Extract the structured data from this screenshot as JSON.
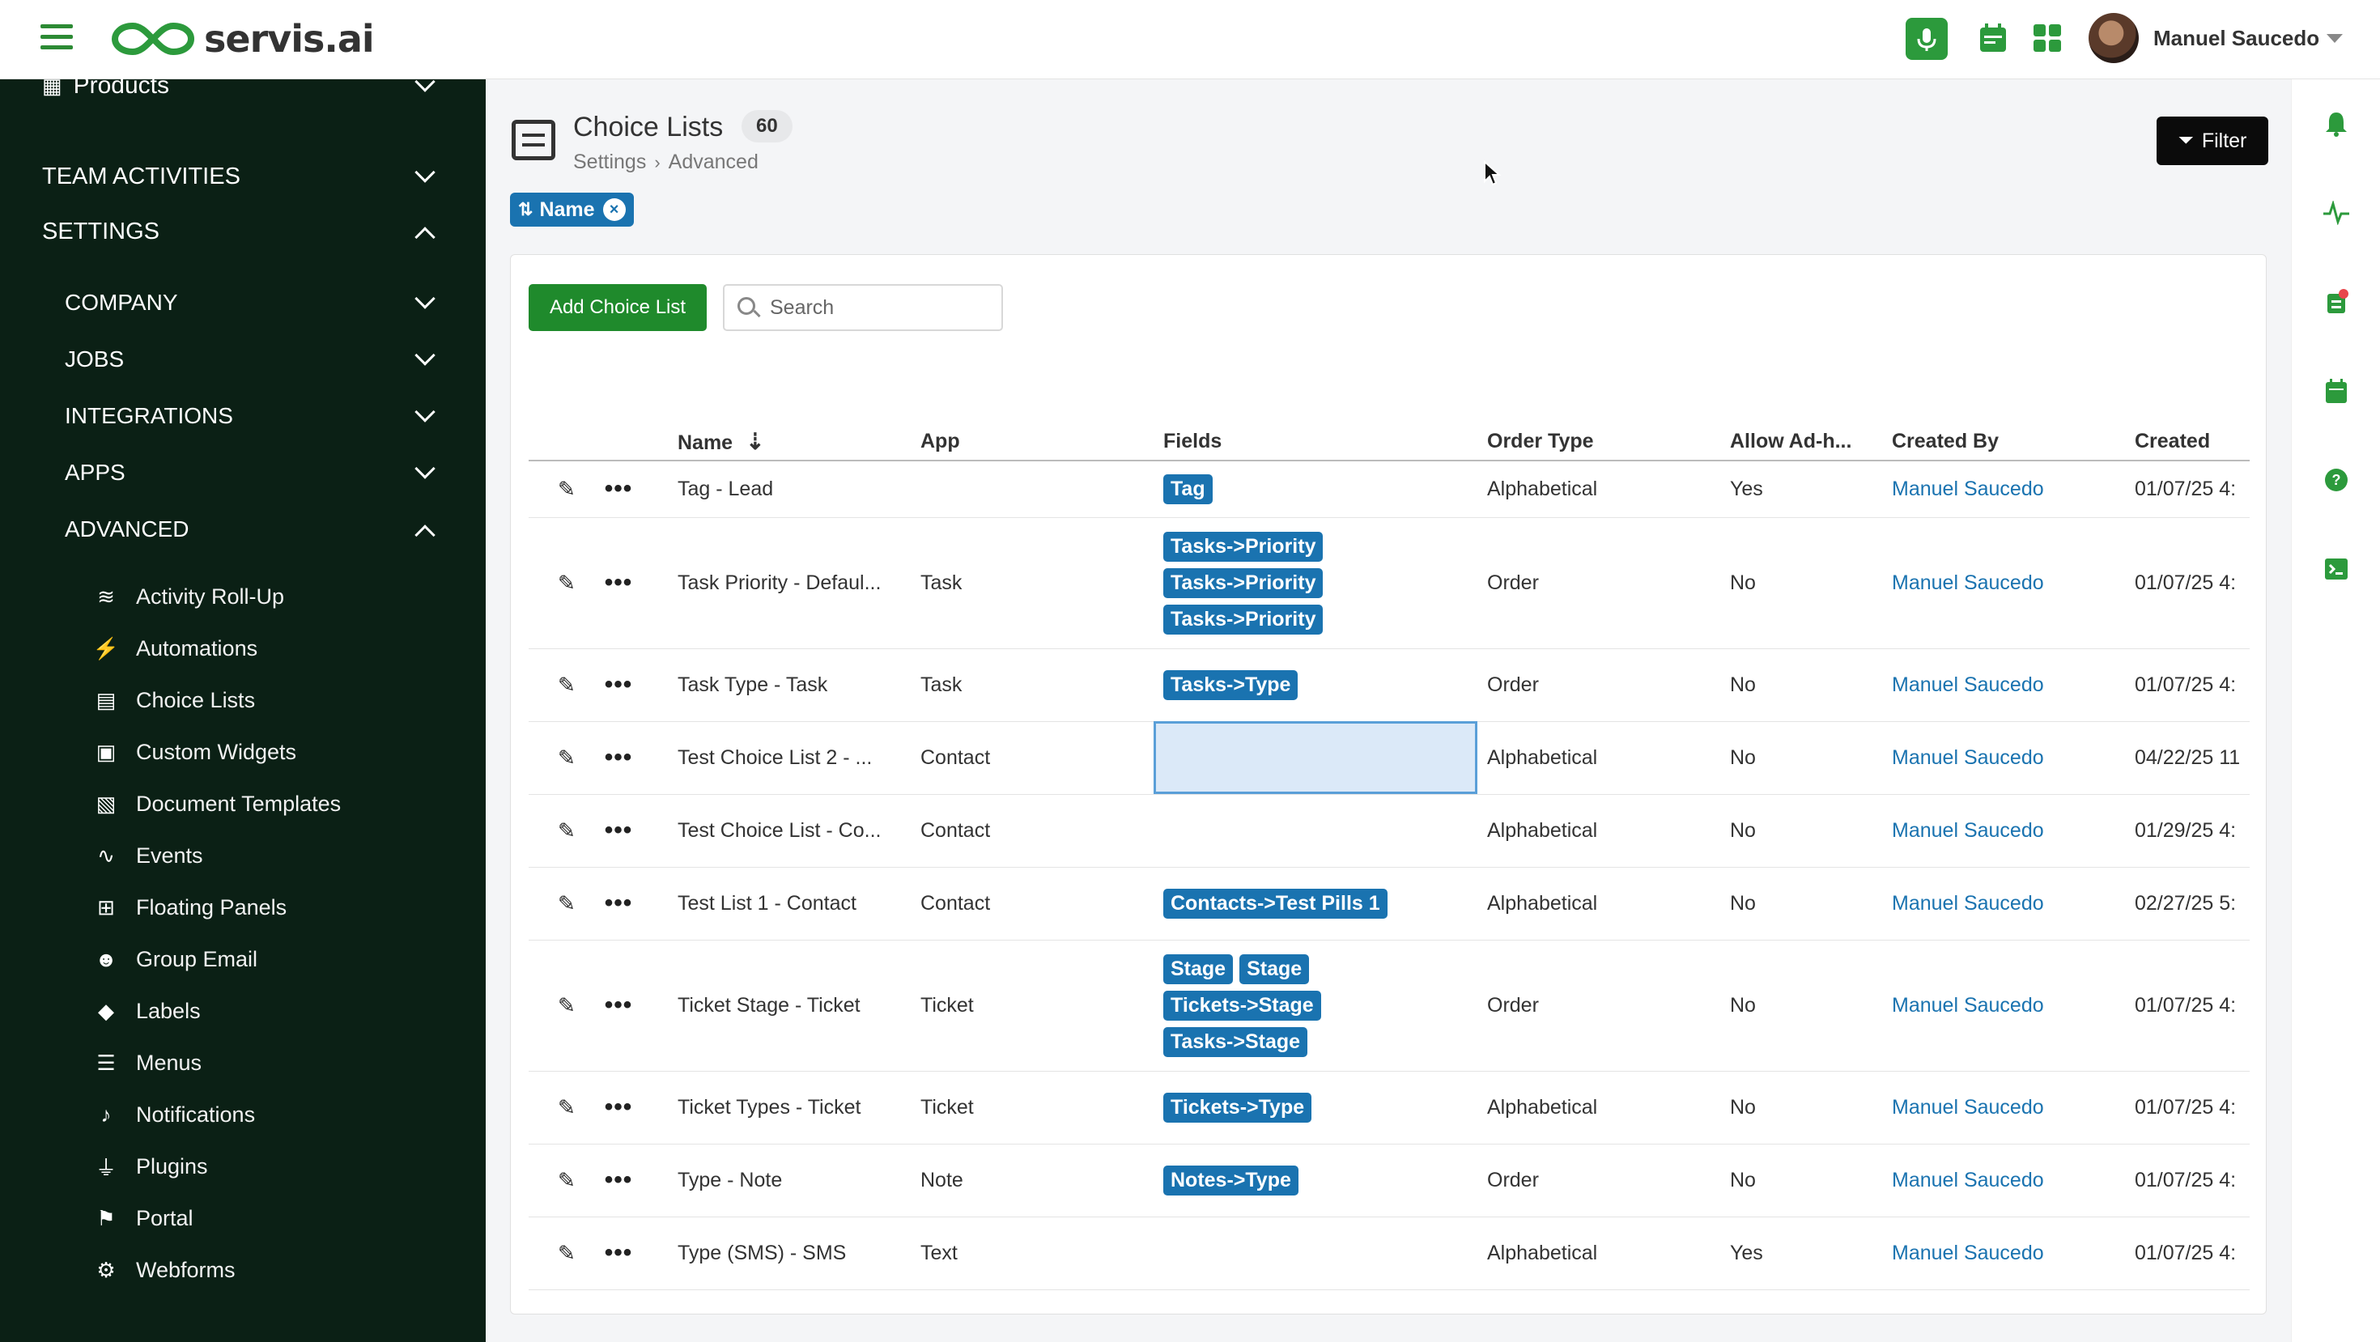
{
  "app": {
    "name": "servis.ai"
  },
  "topbar": {
    "user_name": "Manuel Saucedo"
  },
  "sidebar": {
    "products_label": "Products",
    "team_activities_label": "TEAM ACTIVITIES",
    "settings_label": "SETTINGS",
    "company_label": "COMPANY",
    "jobs_label": "JOBS",
    "integrations_label": "INTEGRATIONS",
    "apps_label": "APPS",
    "advanced_label": "ADVANCED",
    "advanced_items": [
      {
        "label": "Activity Roll-Up",
        "icon": "layers-icon"
      },
      {
        "label": "Automations",
        "icon": "bolt-icon"
      },
      {
        "label": "Choice Lists",
        "icon": "list-icon"
      },
      {
        "label": "Custom Widgets",
        "icon": "widget-icon"
      },
      {
        "label": "Document Templates",
        "icon": "document-icon"
      },
      {
        "label": "Events",
        "icon": "pulse-icon"
      },
      {
        "label": "Floating Panels",
        "icon": "panels-icon"
      },
      {
        "label": "Group Email",
        "icon": "group-icon"
      },
      {
        "label": "Labels",
        "icon": "tag-icon"
      },
      {
        "label": "Menus",
        "icon": "menu-icon"
      },
      {
        "label": "Notifications",
        "icon": "bell-icon"
      },
      {
        "label": "Plugins",
        "icon": "plug-icon"
      },
      {
        "label": "Portal",
        "icon": "portal-icon"
      },
      {
        "label": "Webforms",
        "icon": "webform-icon"
      }
    ]
  },
  "page": {
    "title": "Choice Lists",
    "count": "60",
    "breadcrumb": [
      "Settings",
      "Advanced"
    ],
    "sort_pill": "Name",
    "filter_label": "Filter",
    "add_button": "Add Choice List",
    "search_placeholder": "Search"
  },
  "table": {
    "columns": [
      "Name",
      "App",
      "Fields",
      "Order Type",
      "Allow Ad-h...",
      "Created By",
      "Created"
    ],
    "rows": [
      {
        "name": "Tag - Lead",
        "app": "",
        "fields": [
          "Tag"
        ],
        "order": "Alphabetical",
        "adhoc": "Yes",
        "by": "Manuel Saucedo",
        "created": "01/07/25 4:"
      },
      {
        "name": "Task Priority - Defaul...",
        "app": "Task",
        "fields": [
          "Tasks->Priority",
          "Tasks->Priority",
          "Tasks->Priority"
        ],
        "order": "Order",
        "adhoc": "No",
        "by": "Manuel Saucedo",
        "created": "01/07/25 4:"
      },
      {
        "name": "Task Type - Task",
        "app": "Task",
        "fields": [
          "Tasks->Type"
        ],
        "order": "Order",
        "adhoc": "No",
        "by": "Manuel Saucedo",
        "created": "01/07/25 4:"
      },
      {
        "name": "Test Choice List 2 - ...",
        "app": "Contact",
        "fields": [],
        "order": "Alphabetical",
        "adhoc": "No",
        "by": "Manuel Saucedo",
        "created": "04/22/25 11"
      },
      {
        "name": "Test Choice List - Co...",
        "app": "Contact",
        "fields": [],
        "order": "Alphabetical",
        "adhoc": "No",
        "by": "Manuel Saucedo",
        "created": "01/29/25 4:"
      },
      {
        "name": "Test List 1 - Contact",
        "app": "Contact",
        "fields": [
          "Contacts->Test Pills 1"
        ],
        "order": "Alphabetical",
        "adhoc": "No",
        "by": "Manuel Saucedo",
        "created": "02/27/25 5:"
      },
      {
        "name": "Ticket Stage - Ticket",
        "app": "Ticket",
        "fields": [
          "Stage",
          "Stage",
          "Tickets->Stage",
          "Tasks->Stage"
        ],
        "order": "Order",
        "adhoc": "No",
        "by": "Manuel Saucedo",
        "created": "01/07/25 4:"
      },
      {
        "name": "Ticket Types - Ticket",
        "app": "Ticket",
        "fields": [
          "Tickets->Type"
        ],
        "order": "Alphabetical",
        "adhoc": "No",
        "by": "Manuel Saucedo",
        "created": "01/07/25 4:"
      },
      {
        "name": "Type - Note",
        "app": "Note",
        "fields": [
          "Notes->Type"
        ],
        "order": "Order",
        "adhoc": "No",
        "by": "Manuel Saucedo",
        "created": "01/07/25 4:"
      },
      {
        "name": "Type (SMS) - SMS",
        "app": "Text",
        "fields": [],
        "order": "Alphabetical",
        "adhoc": "Yes",
        "by": "Manuel Saucedo",
        "created": "01/07/25 4:"
      }
    ]
  },
  "colors": {
    "brand_green": "#2c9a3c",
    "sidebar_bg": "#0b2015",
    "tag_blue": "#1a73b0"
  },
  "rail_icons": [
    "bell-icon",
    "activity-icon",
    "checklist-icon",
    "calendar-icon",
    "help-icon",
    "terminal-icon"
  ]
}
